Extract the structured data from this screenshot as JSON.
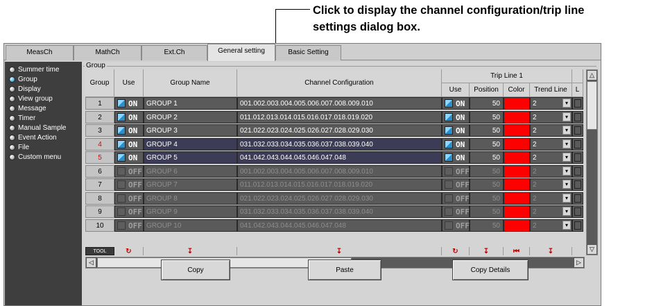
{
  "annotation": {
    "line1": "Click to display the channel configuration/trip line",
    "line2": "settings dialog box."
  },
  "tabs": [
    {
      "label": "MeasCh"
    },
    {
      "label": "MathCh"
    },
    {
      "label": "Ext.Ch"
    },
    {
      "label": "General setting"
    },
    {
      "label": "Basic Setting"
    }
  ],
  "sidebar": {
    "items": [
      {
        "label": "Summer time"
      },
      {
        "label": "Group"
      },
      {
        "label": "Display"
      },
      {
        "label": "View group"
      },
      {
        "label": "Message"
      },
      {
        "label": "Timer"
      },
      {
        "label": "Manual Sample"
      },
      {
        "label": "Event Action"
      },
      {
        "label": "File"
      },
      {
        "label": "Custom menu"
      }
    ]
  },
  "group_box": {
    "label": "Group"
  },
  "table": {
    "headers": {
      "group": "Group",
      "use": "Use",
      "group_name": "Group Name",
      "channel_config": "Channel Configuration",
      "trip_line": "Trip Line 1",
      "trip_use": "Use",
      "position": "Position",
      "color": "Color",
      "trend_line": "Trend Line",
      "trailing": "L"
    },
    "rows": [
      {
        "num": "1",
        "use": "ON",
        "name": "GROUP 1",
        "channels": "001.002.003.004.005.006.007.008.009.010",
        "trip_use": "ON",
        "position": "50",
        "trend": "2"
      },
      {
        "num": "2",
        "use": "ON",
        "name": "GROUP 2",
        "channels": "011.012.013.014.015.016.017.018.019.020",
        "trip_use": "ON",
        "position": "50",
        "trend": "2"
      },
      {
        "num": "3",
        "use": "ON",
        "name": "GROUP 3",
        "channels": "021.022.023.024.025.026.027.028.029.030",
        "trip_use": "ON",
        "position": "50",
        "trend": "2"
      },
      {
        "num": "4",
        "use": "ON",
        "name": "GROUP 4",
        "channels": "031.032.033.034.035.036.037.038.039.040",
        "trip_use": "ON",
        "position": "50",
        "trend": "2"
      },
      {
        "num": "5",
        "use": "ON",
        "name": "GROUP 5",
        "channels": "041.042.043.044.045.046.047.048",
        "trip_use": "ON",
        "position": "50",
        "trend": "2"
      },
      {
        "num": "6",
        "use": "OFF",
        "name": "GROUP 6",
        "channels": "001.002.003.004.005.006.007.008.009.010",
        "trip_use": "OFF",
        "position": "50",
        "trend": "2"
      },
      {
        "num": "7",
        "use": "OFF",
        "name": "GROUP 7",
        "channels": "011.012.013.014.015.016.017.018.019.020",
        "trip_use": "OFF",
        "position": "50",
        "trend": "2"
      },
      {
        "num": "8",
        "use": "OFF",
        "name": "GROUP 8",
        "channels": "021.022.023.024.025.026.027.028.029.030",
        "trip_use": "OFF",
        "position": "50",
        "trend": "2"
      },
      {
        "num": "9",
        "use": "OFF",
        "name": "GROUP 9",
        "channels": "031.032.033.034.035.036.037.038.039.040",
        "trip_use": "OFF",
        "position": "50",
        "trend": "2"
      },
      {
        "num": "10",
        "use": "OFF",
        "name": "GROUP 10",
        "channels": "041.042.043.044.045.046.047.048",
        "trip_use": "OFF",
        "position": "50",
        "trend": "2"
      }
    ],
    "tool_label": "TOOL"
  },
  "buttons": {
    "copy": "Copy",
    "paste": "Paste",
    "copy_details": "Copy Details"
  },
  "colors": {
    "trip_line_color": "#ff0000",
    "row_number_highlight": "#e00000",
    "selected_row": "#3c3c56"
  }
}
